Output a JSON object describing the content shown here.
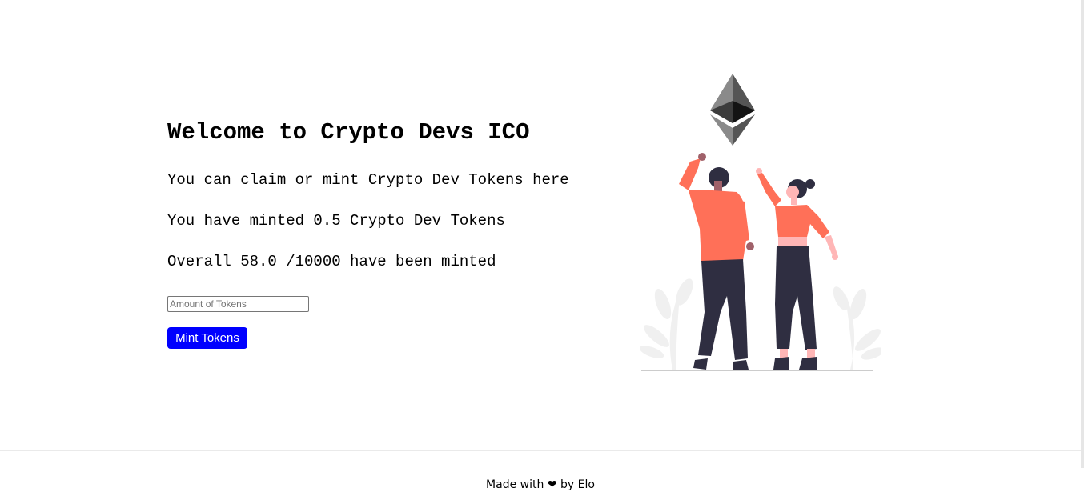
{
  "main": {
    "title": "Welcome to Crypto Devs ICO",
    "description": "You can claim or mint Crypto Dev Tokens here",
    "minted_by_user": "You have minted 0.5 Crypto Dev Tokens",
    "overall_minted": "Overall 58.0 /10000 have been minted",
    "amount_input": {
      "placeholder": "Amount of Tokens",
      "value": ""
    },
    "mint_button_label": "Mint Tokens",
    "illustration_icon": "ethereum-logo-with-people-illustration"
  },
  "footer": {
    "made_with": "Made with",
    "heart_icon": "heart-icon",
    "heart_glyph": "❤",
    "by_author": "by Elo"
  },
  "colors": {
    "button_bg": "#0000ff",
    "button_text": "#ffffff",
    "accent_orange": "#ff7058",
    "dark_clothing": "#2f2e41"
  }
}
